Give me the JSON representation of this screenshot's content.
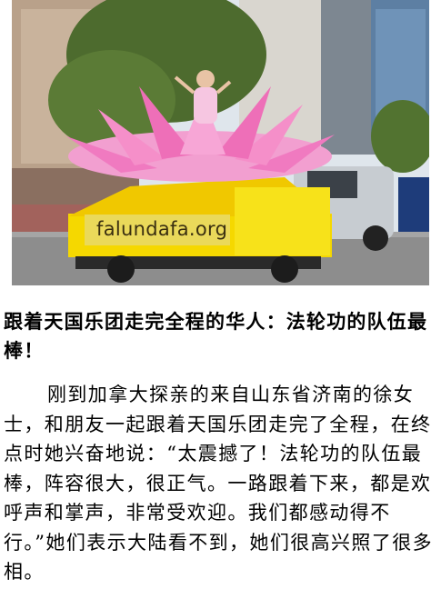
{
  "photo": {
    "description_icon": "parade-lotus-float-photo",
    "float_banner": "falundafa.org",
    "colors": {
      "lotus": "#f07ac0",
      "float": "#f5d800",
      "sky": "#dfe6ec",
      "road": "#8d8d8d"
    }
  },
  "article": {
    "headline": "跟着天国乐团走完全程的华人：法轮功的队伍最棒！",
    "paragraph": "刚到加拿大探亲的来自山东省济南的徐女士，和朋友一起跟着天国乐团走完了全程，在终点时她兴奋地说：“太震撼了！法轮功的队伍最棒，阵容很大，很正气。一路跟着下来，都是欢呼声和掌声，非常受欢迎。我们都感动得不行。”她们表示大陆看不到，她们很高兴照了很多相。"
  }
}
